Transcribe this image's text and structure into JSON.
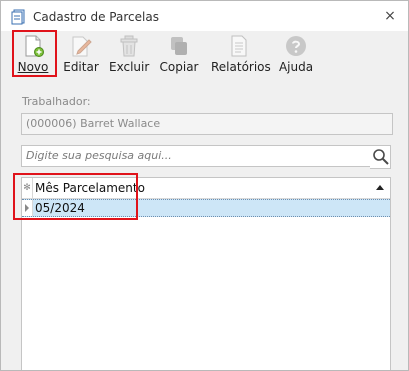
{
  "window": {
    "title": "Cadastro de Parcelas",
    "close_glyph": "×"
  },
  "toolbar": {
    "buttons": [
      {
        "id": "novo",
        "label": "Novo",
        "icon": "new-document-icon"
      },
      {
        "id": "editar",
        "label": "Editar",
        "icon": "edit-pencil-icon"
      },
      {
        "id": "excluir",
        "label": "Excluir",
        "icon": "trash-icon"
      },
      {
        "id": "copiar",
        "label": "Copiar",
        "icon": "copy-icon"
      },
      {
        "id": "relatorios",
        "label": "Relatórios",
        "icon": "report-icon"
      },
      {
        "id": "ajuda",
        "label": "Ajuda",
        "icon": "help-icon"
      }
    ]
  },
  "form": {
    "trabalhador_label": "Trabalhador:",
    "trabalhador_value": "(000006) Barret Wallace"
  },
  "search": {
    "placeholder": "Digite sua pesquisa aqui..."
  },
  "grid": {
    "header_indicator": "✻",
    "columns": [
      {
        "label": "Mês Parcelamento",
        "sort": "ascending"
      }
    ],
    "rows": [
      {
        "mes_parcelamento": "05/2024",
        "selected": true
      }
    ]
  },
  "colors": {
    "highlight": "#e0131b",
    "selected_row": "#cde6f7",
    "window_bg": "#f0f0f0"
  }
}
